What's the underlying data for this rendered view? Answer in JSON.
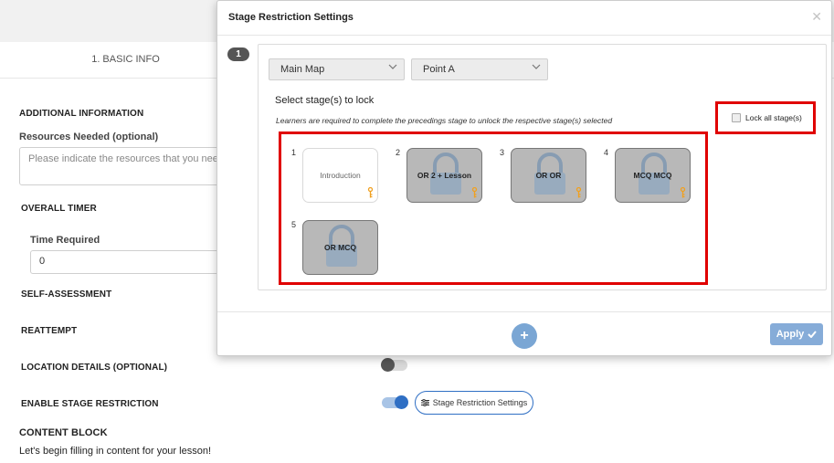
{
  "background": {
    "tab_basic_info": "1. BASIC INFO",
    "additional_information": "ADDITIONAL INFORMATION",
    "resources_label": "Resources Needed (optional)",
    "resources_placeholder": "Please indicate the resources that you need",
    "overall_timer": "OVERALL TIMER",
    "time_required_label": "Time Required",
    "time_required_value": "0",
    "self_assessment": "SELF-ASSESSMENT",
    "reattempt": "REATTEMPT",
    "location_details": "LOCATION DETAILS (OPTIONAL)",
    "location_toggle_on": false,
    "enable_stage_restriction": "ENABLE STAGE RESTRICTION",
    "stage_restriction_toggle_on": true,
    "stage_restriction_button": "Stage Restriction Settings",
    "content_block": "CONTENT BLOCK",
    "content_block_text": "Let's begin filling in content for your lesson!"
  },
  "modal": {
    "title": "Stage Restriction Settings",
    "close_icon": "close-icon",
    "stage_number": "1",
    "map_select": "Main Map",
    "point_select": "Point A",
    "lock_heading": "Select stage(s) to lock",
    "lock_description": "Learners are required to complete the precedings stage to unlock the respective stage(s) selected",
    "lock_all_label": "Lock all stage(s)",
    "lock_all_checked": false,
    "stages": [
      {
        "index": "1",
        "label": "Introduction",
        "locked": false
      },
      {
        "index": "2",
        "label": "OR 2 + Lesson",
        "locked": true
      },
      {
        "index": "3",
        "label": "OR OR",
        "locked": true
      },
      {
        "index": "4",
        "label": "MCQ MCQ",
        "locked": true
      },
      {
        "index": "5",
        "label": "OR MCQ",
        "locked": true
      }
    ],
    "add_button": "+",
    "apply_button": "Apply",
    "highlight_color": "#e00000",
    "accent_color": "#2f6fc4"
  }
}
